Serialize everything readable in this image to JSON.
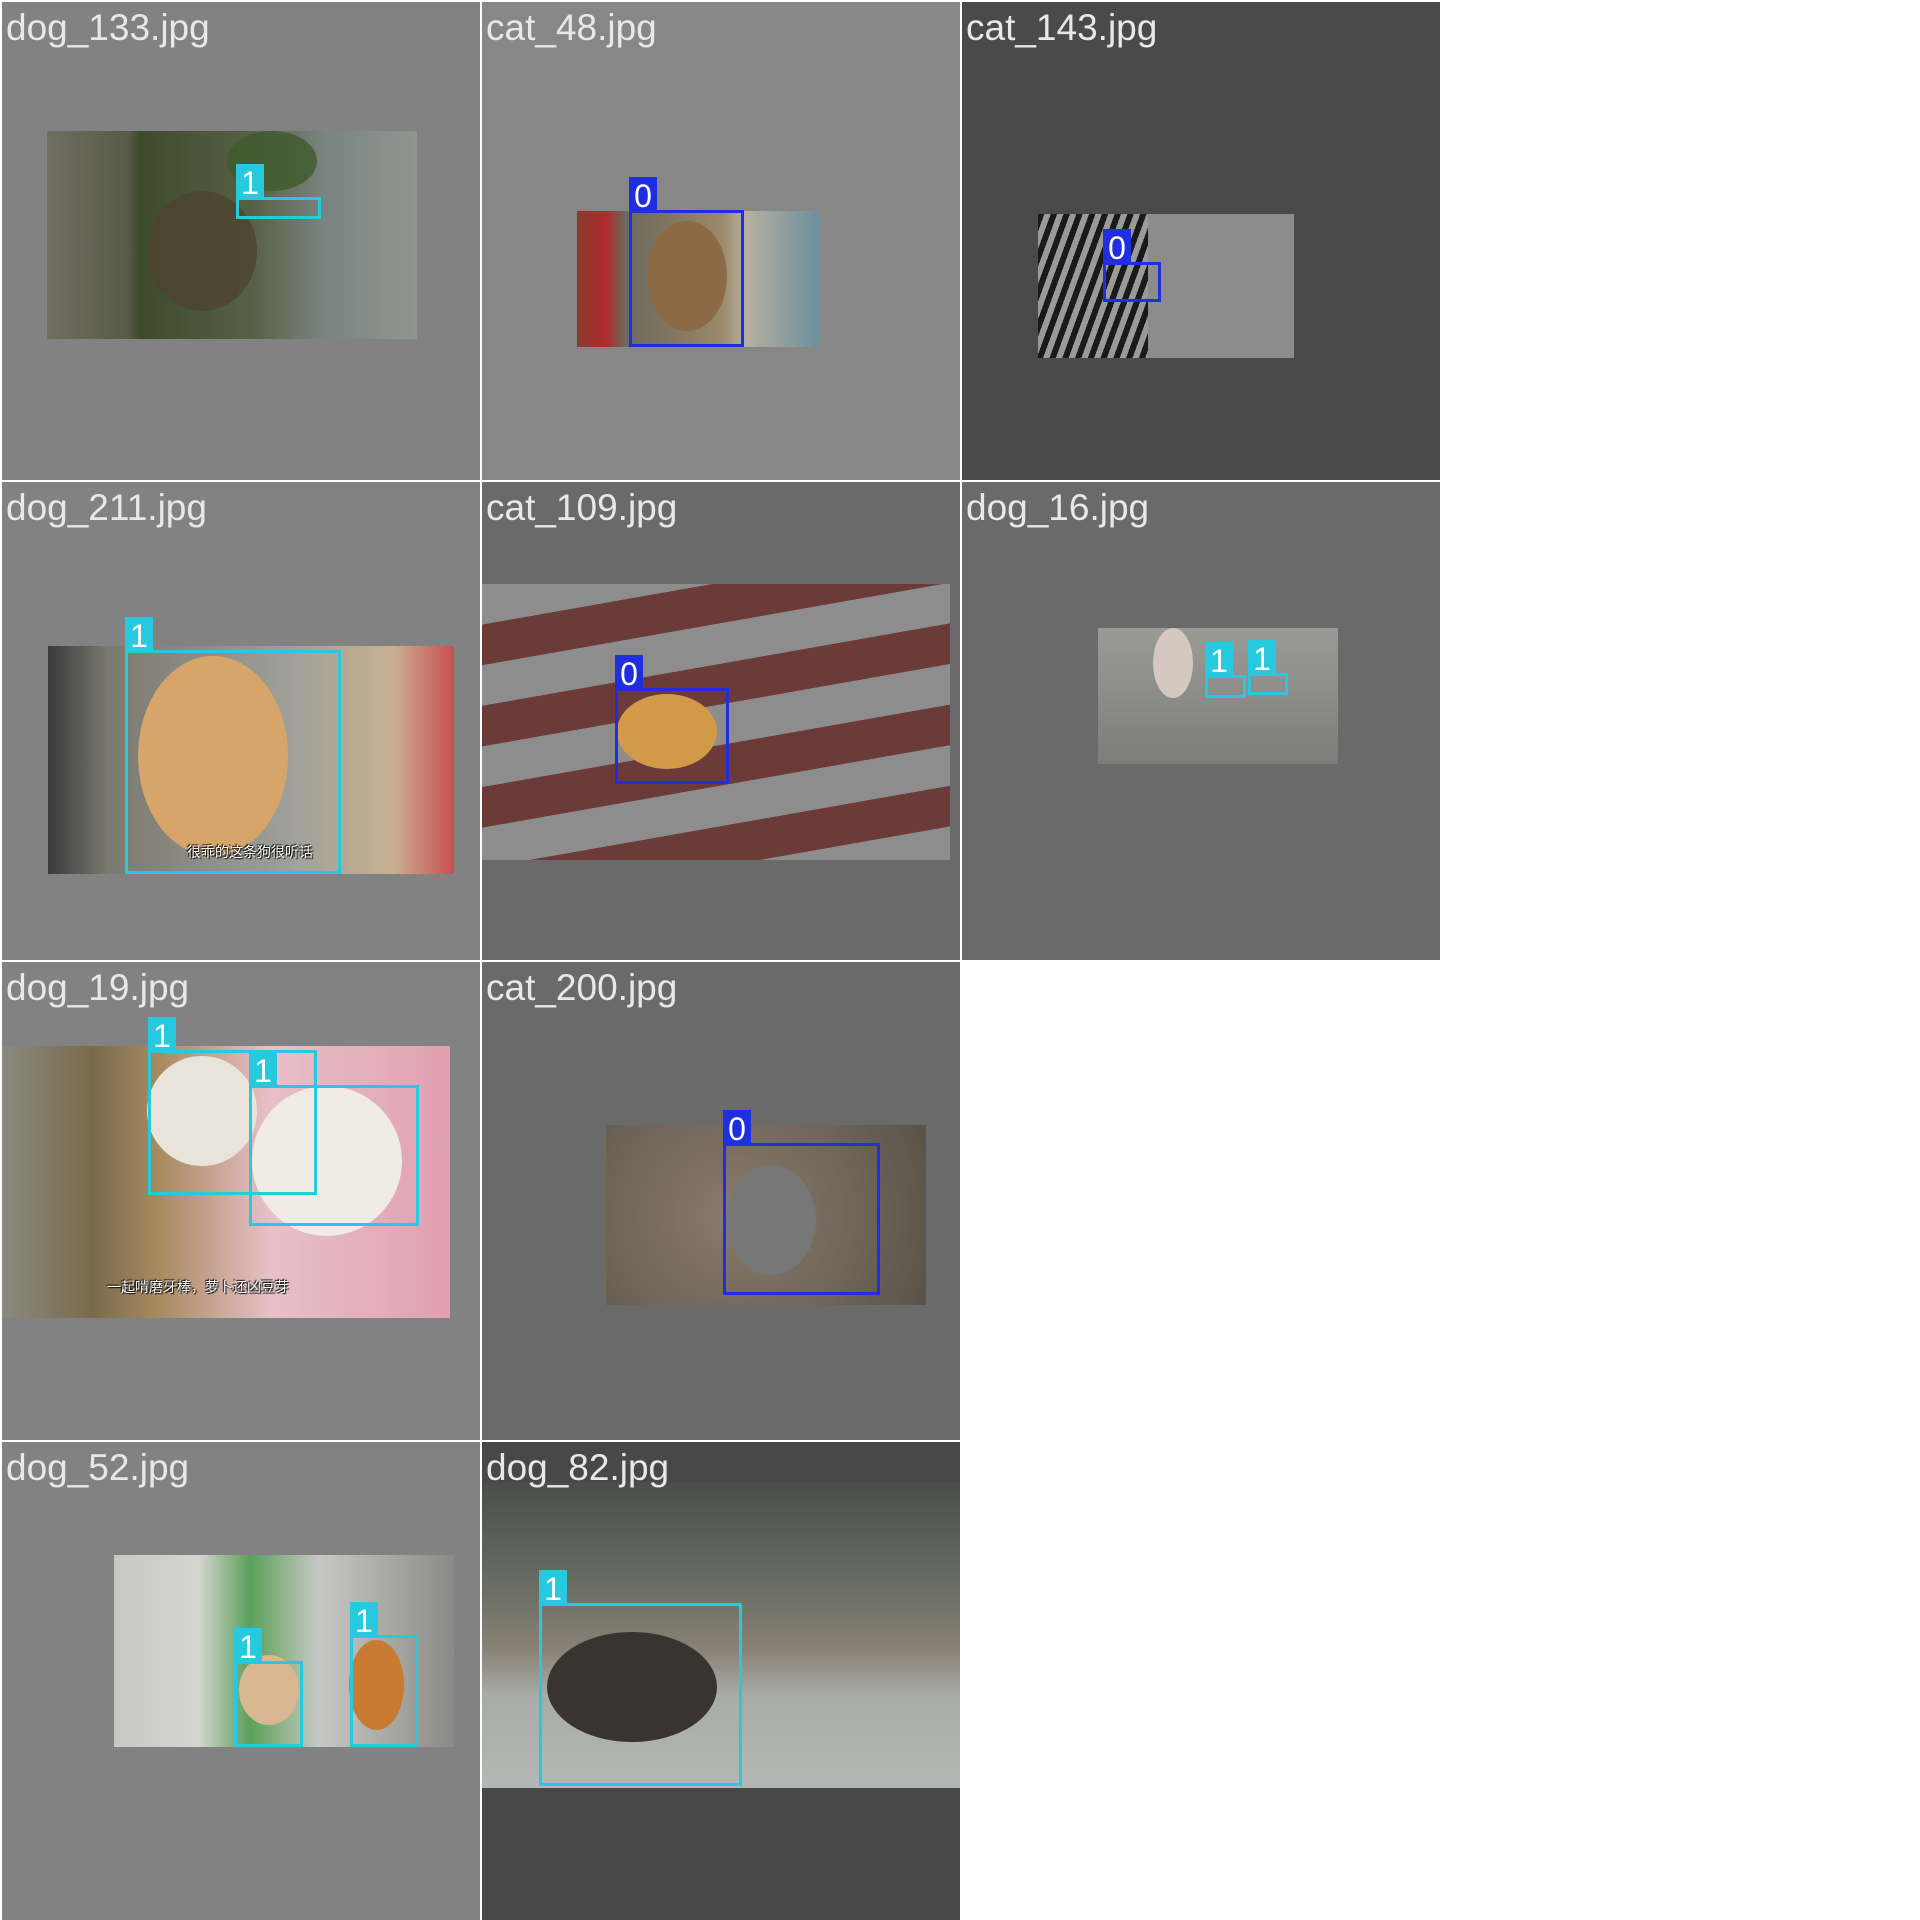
{
  "tiles": [
    {
      "title": "dog_133.jpg",
      "boxes": [
        {
          "class_label": "1"
        }
      ]
    },
    {
      "title": "cat_48.jpg",
      "boxes": [
        {
          "class_label": "0"
        }
      ]
    },
    {
      "title": "cat_143.jpg",
      "boxes": [
        {
          "class_label": "0"
        }
      ]
    },
    {
      "title": "dog_211.jpg",
      "boxes": [
        {
          "class_label": "1"
        }
      ],
      "caption": "很乖的这条狗很听话"
    },
    {
      "title": "cat_109.jpg",
      "boxes": [
        {
          "class_label": "0"
        }
      ]
    },
    {
      "title": "dog_16.jpg",
      "boxes": [
        {
          "class_label": "1"
        },
        {
          "class_label": "1"
        }
      ]
    },
    {
      "title": "dog_19.jpg",
      "boxes": [
        {
          "class_label": "1"
        },
        {
          "class_label": "1"
        }
      ],
      "caption": "一起啃磨牙棒，萝卜还凶豆芽"
    },
    {
      "title": "cat_200.jpg",
      "boxes": [
        {
          "class_label": "0"
        }
      ]
    },
    {
      "title": "dog_52.jpg",
      "boxes": [
        {
          "class_label": "1"
        },
        {
          "class_label": "1"
        }
      ]
    },
    {
      "title": "dog_82.jpg",
      "boxes": [
        {
          "class_label": "1"
        }
      ]
    }
  ],
  "colors": {
    "class_0_box": "#1f2fe0",
    "class_1_box": "#26c9dd",
    "tile_title_text": "#e8e8e8"
  }
}
